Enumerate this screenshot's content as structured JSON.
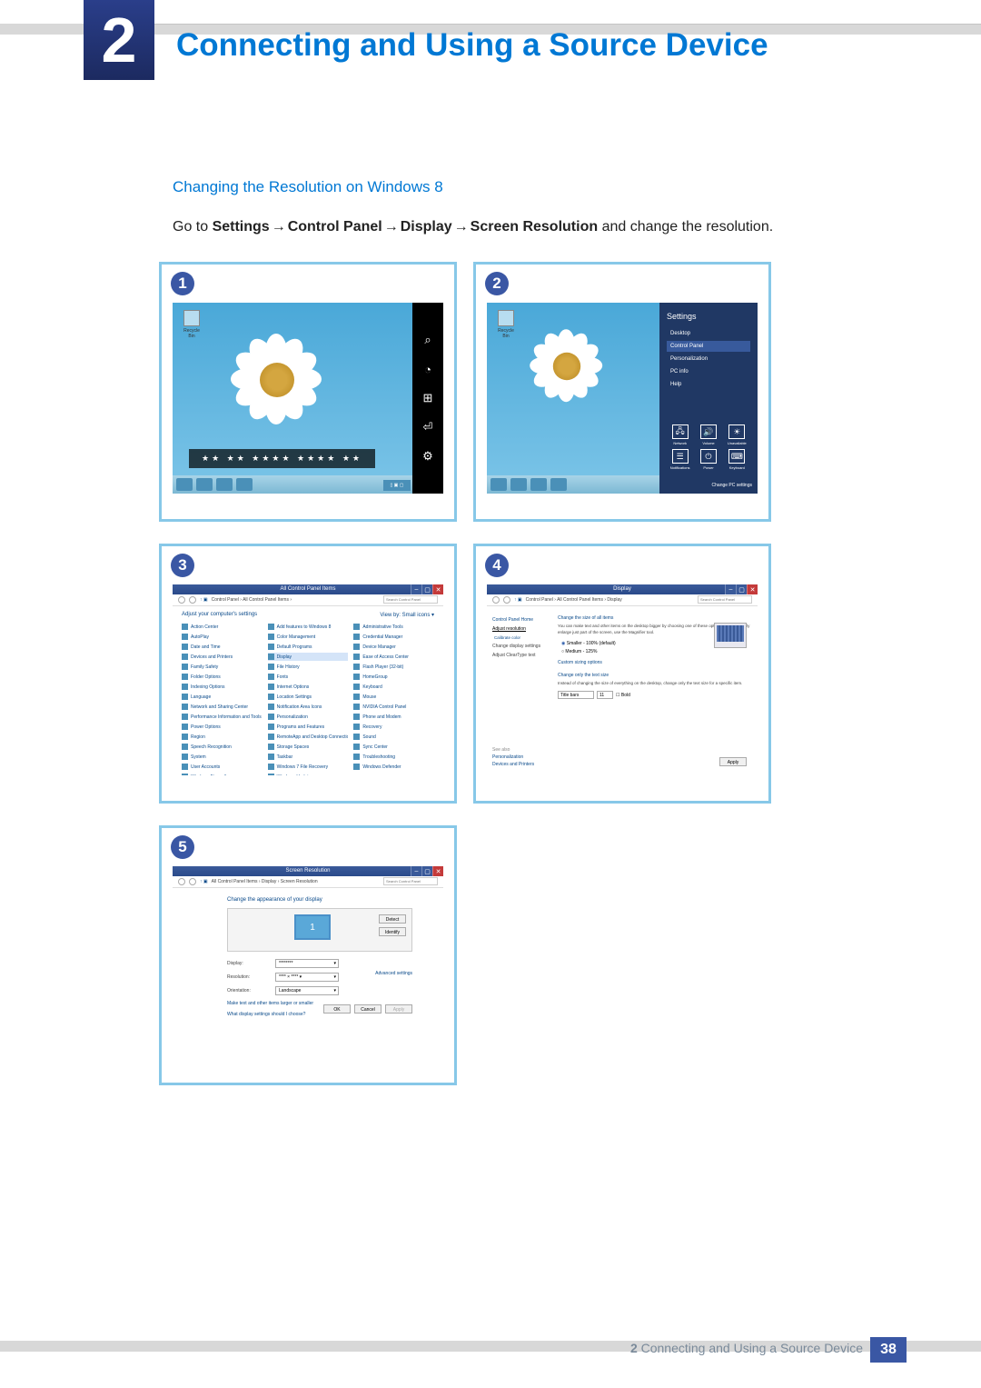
{
  "header": {
    "chapter_number": "2",
    "chapter_title": "Connecting and Using a Source Device"
  },
  "content": {
    "subheading": "Changing the Resolution on Windows 8",
    "instruction_prefix": "Go to ",
    "path": [
      "Settings",
      "Control Panel",
      "Display",
      "Screen Resolution"
    ],
    "instruction_suffix": " and change the resolution.",
    "arrow": "→"
  },
  "screenshots": {
    "s1": {
      "badge": "1",
      "recycle_label": "Recycle Bin",
      "charms": [
        "search-icon",
        "share-icon",
        "start-icon",
        "devices-icon",
        "settings-icon"
      ],
      "charm_glyphs": [
        "⌕",
        "◔",
        "⊞",
        "⏎",
        "⚙"
      ],
      "status_overlay": "★★   ★★     ★★★★\n              ★★★★  ★★",
      "time_box": "▯ ▣ ▢"
    },
    "s2": {
      "badge": "2",
      "panel_title": "Settings",
      "panel_items": [
        "Desktop",
        "Control Panel",
        "Personalization",
        "PC info",
        "Help"
      ],
      "panel_item_hl_index": 1,
      "quick_tiles": [
        {
          "icon": "🖧",
          "label": "Network"
        },
        {
          "icon": "🔊",
          "label": "Volume"
        },
        {
          "icon": "☀",
          "label": "Unavailable"
        },
        {
          "icon": "☰",
          "label": "Notifications"
        },
        {
          "icon": "⏻",
          "label": "Power"
        },
        {
          "icon": "⌨",
          "label": "Keyboard"
        }
      ],
      "change_pc": "Change PC settings"
    },
    "s3": {
      "badge": "3",
      "window_title": "All Control Panel Items",
      "breadcrumb": "Control Panel › All Control Panel Items ›",
      "search_placeholder": "Search Control Panel",
      "adjust": "Adjust your computer's settings",
      "view_by": "View by:   Small icons ▾",
      "items": [
        "Action Center",
        "Add features to Windows 8",
        "Administrative Tools",
        "AutoPlay",
        "Color Management",
        "Credential Manager",
        "Date and Time",
        "Default Programs",
        "Device Manager",
        "Devices and Printers",
        "Display",
        "Ease of Access Center",
        "Family Safety",
        "File History",
        "Flash Player (32-bit)",
        "Folder Options",
        "Fonts",
        "HomeGroup",
        "Indexing Options",
        "Internet Options",
        "Keyboard",
        "Language",
        "Location Settings",
        "Mouse",
        "Network and Sharing Center",
        "Notification Area Icons",
        "NVIDIA Control Panel",
        "Performance Information and Tools",
        "Personalization",
        "Phone and Modem",
        "Power Options",
        "Programs and Features",
        "Recovery",
        "Region",
        "RemoteApp and Desktop Connections",
        "Sound",
        "Speech Recognition",
        "Storage Spaces",
        "Sync Center",
        "System",
        "Taskbar",
        "Troubleshooting",
        "User Accounts",
        "Windows 7 File Recovery",
        "Windows Defender",
        "Windows Firewall",
        "Windows Update",
        ""
      ],
      "highlight_index": 10
    },
    "s4": {
      "badge": "4",
      "window_title": "Display",
      "breadcrumb": "Control Panel › All Control Panel Items › Display",
      "search_placeholder": "Search Control Panel",
      "side_header": "Control Panel Home",
      "side_items": [
        "Adjust resolution",
        "Calibrate color",
        "Change display settings",
        "Adjust ClearType text"
      ],
      "side_hl_index": 0,
      "section1_head": "Change the size of all items",
      "section1_body": "You can make text and other items on the desktop bigger by choosing one of these options. To temporarily enlarge just part of the screen, use the Magnifier tool.",
      "radio1": "Smaller - 100% (default)",
      "radio2": "Medium - 125%",
      "custom_link": "Custom sizing options",
      "section2_head": "Change only the text size",
      "section2_body": "Instead of changing the size of everything on the desktop, change only the text size for a specific item.",
      "combo_label": "Title bars",
      "combo_size": "11",
      "bold_check": "Bold",
      "apply_btn": "Apply",
      "see_also": "See also",
      "see_items": [
        "Personalization",
        "Devices and Printers"
      ]
    },
    "s5": {
      "badge": "5",
      "window_title": "Screen Resolution",
      "breadcrumb": "All Control Panel Items › Display › Screen Resolution",
      "search_placeholder": "Search Control Panel",
      "main_head": "Change the appearance of your display",
      "detect_btn": "Detect",
      "identify_btn": "Identify",
      "monitor_num": "1",
      "display_label": "Display:",
      "display_val": "********",
      "resolution_label": "Resolution:",
      "resolution_val": "**** × **** ▾",
      "orientation_label": "Orientation:",
      "orientation_val": "Landscape",
      "adv_link": "Advanced settings",
      "link1": "Make text and other items larger or smaller",
      "link2": "What display settings should I choose?",
      "ok_btn": "OK",
      "cancel_btn": "Cancel",
      "apply_btn": "Apply"
    }
  },
  "footer": {
    "chapter_ref": "2",
    "chapter_title": "Connecting and Using a Source Device",
    "page_number": "38"
  }
}
